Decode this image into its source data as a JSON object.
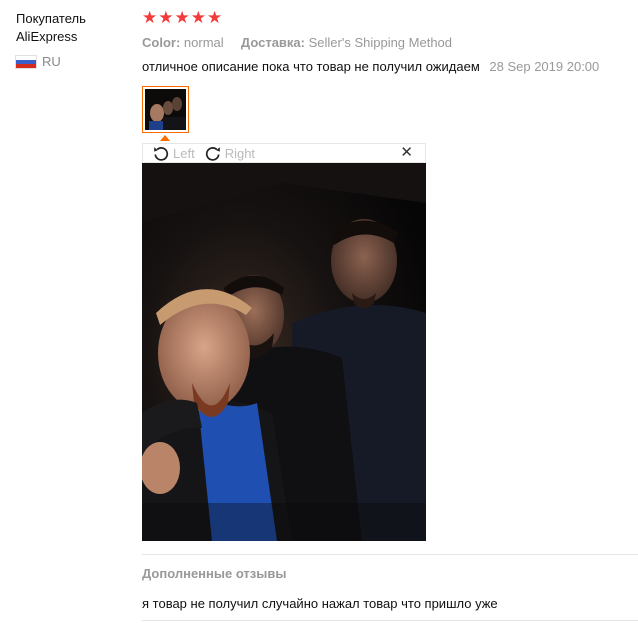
{
  "buyer": {
    "name_line1": "Покупатель",
    "name_line2": "AliExpress",
    "country_code": "RU",
    "flag_colors": [
      "#ffffff",
      "#3b5fc9",
      "#d52b1e"
    ]
  },
  "review": {
    "rating": 5,
    "star_glyph": "★",
    "star_color": "#f33b3b",
    "color_label": "Color:",
    "color_value": "normal",
    "shipping_label": "Доставка:",
    "shipping_value": "Seller's Shipping Method",
    "comment": "отличное описание пока что товар не получил ожидаем",
    "date": "28 Sep 2019 20:00",
    "accent_color": "#ff6a00"
  },
  "viewer": {
    "rotate_left_label": "Left",
    "rotate_right_label": "Right",
    "close_glyph": "✕",
    "icons": [
      "rotate-left-icon",
      "rotate-right-icon",
      "close-icon"
    ]
  },
  "followup": {
    "title": "Дополненные отзывы",
    "text": "я товар не получил случайно нажал товар что пришло уже"
  }
}
